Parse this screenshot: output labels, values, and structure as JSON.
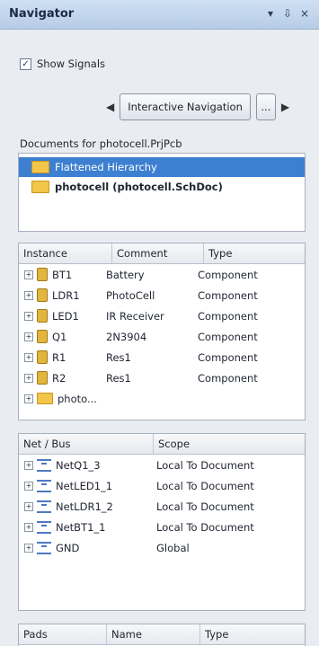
{
  "window": {
    "title": "Navigator",
    "controls": [
      "▾",
      "⇩",
      "×"
    ]
  },
  "options": {
    "show_signals_label": "Show Signals",
    "show_signals_checked": true,
    "mode_button": "Interactive Navigation",
    "more_button": "..."
  },
  "documents": {
    "label": "Documents for photocell.PrjPcb",
    "items": [
      {
        "label": "Flattened Hierarchy",
        "selected": true
      },
      {
        "label": "photocell (photocell.SchDoc)",
        "selected": false
      }
    ]
  },
  "instances": {
    "columns": [
      "Instance",
      "Comment",
      "Type"
    ],
    "rows": [
      {
        "instance": "BT1",
        "comment": "Battery",
        "type": "Component"
      },
      {
        "instance": "LDR1",
        "comment": "PhotoCell",
        "type": "Component"
      },
      {
        "instance": "LED1",
        "comment": "IR Receiver",
        "type": "Component"
      },
      {
        "instance": "Q1",
        "comment": "2N3904",
        "type": "Component"
      },
      {
        "instance": "R1",
        "comment": "Res1",
        "type": "Component"
      },
      {
        "instance": "R2",
        "comment": "Res1",
        "type": "Component"
      },
      {
        "instance": "photo...",
        "comment": "",
        "type": ""
      }
    ]
  },
  "nets": {
    "columns": [
      "Net / Bus",
      "Scope"
    ],
    "rows": [
      {
        "net": "NetQ1_3",
        "scope": "Local To Document"
      },
      {
        "net": "NetLED1_1",
        "scope": "Local To Document"
      },
      {
        "net": "NetLDR1_2",
        "scope": "Local To Document"
      },
      {
        "net": "NetBT1_1",
        "scope": "Local To Document"
      },
      {
        "net": "GND",
        "scope": "Global"
      }
    ]
  },
  "pads": {
    "columns": [
      "Pads",
      "Name",
      "Type"
    ]
  }
}
